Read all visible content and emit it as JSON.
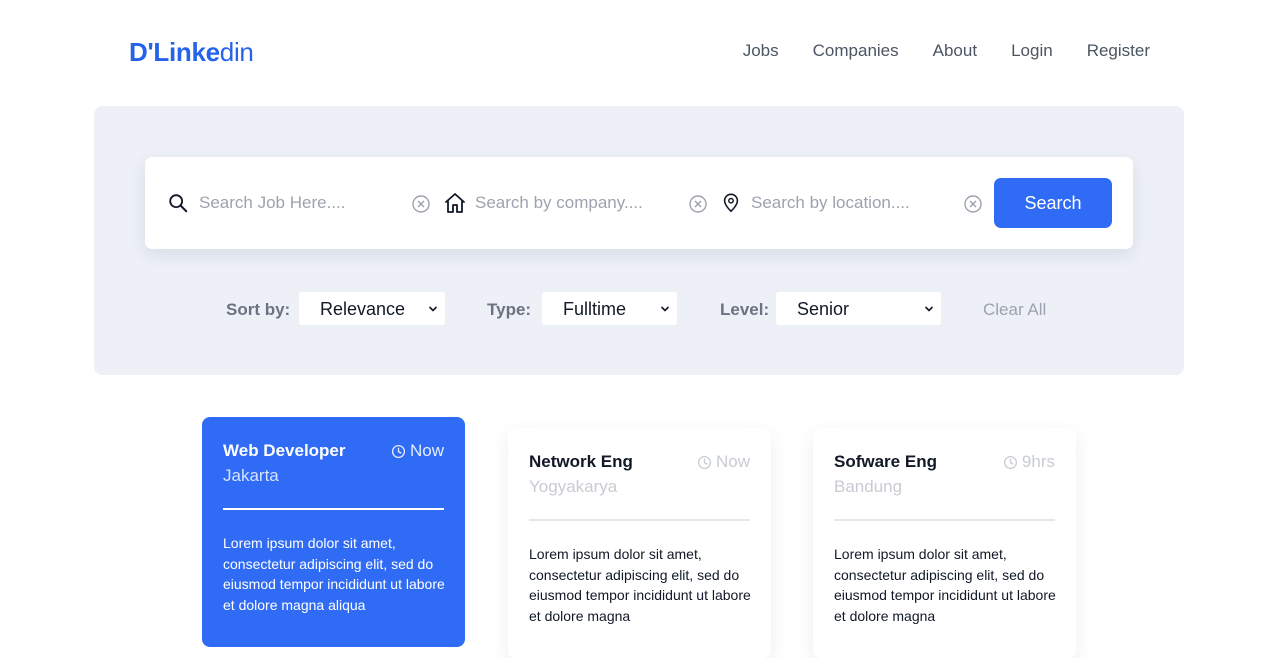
{
  "header": {
    "logo_bold": "D'Linke",
    "logo_light": "din",
    "nav": [
      "Jobs",
      "Companies",
      "About",
      "Login",
      "Register"
    ]
  },
  "search": {
    "job_placeholder": "Search Job Here....",
    "company_placeholder": "Search by company....",
    "location_placeholder": "Search by location....",
    "button_label": "Search",
    "icons": [
      "search-icon",
      "home-icon",
      "map-pin-icon",
      "clear-icon"
    ]
  },
  "filters": {
    "sort_label": "Sort by:",
    "sort_value": "Relevance",
    "type_label": "Type:",
    "type_value": "Fulltime",
    "level_label": "Level:",
    "level_value": "Senior",
    "clear_all": "Clear All"
  },
  "jobs": [
    {
      "title": "Web Developer",
      "location": "Jakarta",
      "time": "Now",
      "description": "Lorem ipsum dolor sit amet, consectetur adipiscing elit, sed do eiusmod tempor incididunt ut labore et dolore magna aliqua"
    },
    {
      "title": "Network Eng",
      "location": "Yogyakarya",
      "time": "Now",
      "description": "Lorem ipsum dolor sit amet, consectetur adipiscing elit, sed do eiusmod tempor incididunt ut labore et dolore magna"
    },
    {
      "title": "Sofware Eng",
      "location": "Bandung",
      "time": "9hrs",
      "description": "Lorem ipsum dolor sit amet, consectetur adipiscing elit, sed do eiusmod tempor incididunt ut labore et dolore magna"
    }
  ],
  "colors": {
    "accent": "#2f6bf4",
    "hero_bg": "#edf1f7",
    "muted": "#9ca3af"
  }
}
